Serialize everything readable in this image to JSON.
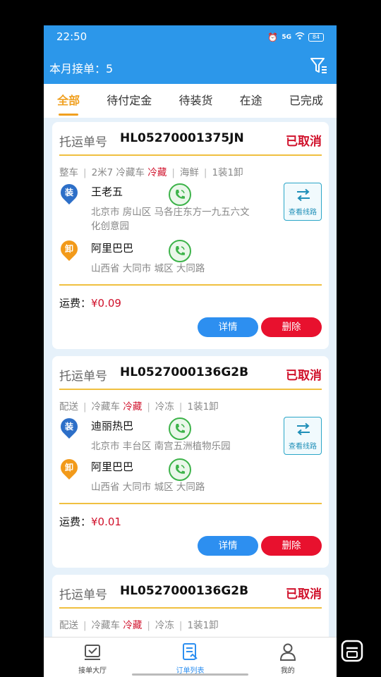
{
  "status_bar": {
    "time": "22:50",
    "network": "5G",
    "battery": "84"
  },
  "header": {
    "month_orders_label": "本月接单：5"
  },
  "tabs": [
    {
      "label": "全部",
      "active": true
    },
    {
      "label": "待付定金",
      "active": false
    },
    {
      "label": "待装货",
      "active": false
    },
    {
      "label": "在途",
      "active": false
    },
    {
      "label": "已完成",
      "active": false
    }
  ],
  "order_label": "托运单号",
  "route_button_label": "查看线路",
  "freight_label": "运费：",
  "detail_label": "详情",
  "delete_label": "删除",
  "load_badge": "装",
  "unload_badge": "卸",
  "orders": [
    {
      "order_no": "HL05270001375JN",
      "status": "已取消",
      "tags": [
        "整车",
        "2米7 冷藏车",
        "冷藏",
        "海鲜",
        "1装1卸"
      ],
      "loader_name": "王老五",
      "loader_addr_1": "北京市 房山区 马各庄东方一九五六文",
      "loader_addr_2": "化创意园",
      "unloader_name": "阿里巴巴",
      "unloader_addr": "山西省 大同市 城区 大同路",
      "freight": "¥0.09"
    },
    {
      "order_no": "HL0527000136G2B",
      "status": "已取消",
      "tags": [
        "配送",
        "冷藏车",
        "冷藏",
        "冷冻",
        "1装1卸"
      ],
      "loader_name": "迪丽热巴",
      "loader_addr_1": "北京市 丰台区 南宫五洲植物乐园",
      "unloader_name": "阿里巴巴",
      "unloader_addr": "山西省 大同市 城区 大同路",
      "freight": "¥0.01"
    },
    {
      "order_no": "HL0527000136G2B",
      "status": "已取消",
      "tags": [
        "配送",
        "冷藏车",
        "冷藏",
        "冷冻",
        "1装1卸"
      ]
    }
  ],
  "bottom_nav": [
    {
      "label": "接单大厅",
      "icon": "hall-icon",
      "active": false
    },
    {
      "label": "订单列表",
      "icon": "order-list-icon",
      "active": true
    },
    {
      "label": "我的",
      "icon": "profile-icon",
      "active": false
    }
  ],
  "colors": {
    "primary": "#2c97ea",
    "accent": "#f0a020",
    "cancel": "#d0112b",
    "delete": "#e8112e",
    "detail": "#2d8ff0"
  }
}
